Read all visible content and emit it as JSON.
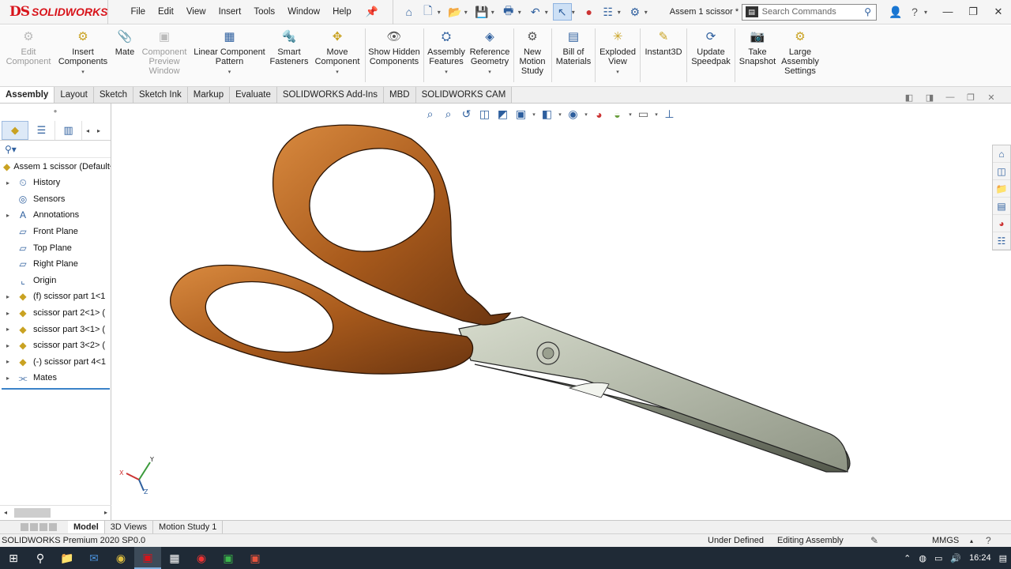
{
  "app": {
    "logo_ds": "DS",
    "logo_text": "SOLIDWORKS",
    "doc_title": "Assem 1 scissor *"
  },
  "menu": [
    "File",
    "Edit",
    "View",
    "Insert",
    "Tools",
    "Window",
    "Help"
  ],
  "search": {
    "placeholder": "Search Commands"
  },
  "commands": [
    {
      "label": "Edit Component",
      "disabled": true
    },
    {
      "label": "Insert Components",
      "disabled": false
    },
    {
      "label": "Mate",
      "disabled": false
    },
    {
      "label": "Component Preview Window",
      "disabled": true
    },
    {
      "label": "Linear Component Pattern",
      "disabled": false
    },
    {
      "label": "Smart Fasteners",
      "disabled": false
    },
    {
      "label": "Move Component",
      "disabled": false
    },
    {
      "label": "Show Hidden Components",
      "disabled": false
    },
    {
      "label": "Assembly Features",
      "disabled": false
    },
    {
      "label": "Reference Geometry",
      "disabled": false
    },
    {
      "label": "New Motion Study",
      "disabled": false
    },
    {
      "label": "Bill of Materials",
      "disabled": false
    },
    {
      "label": "Exploded View",
      "disabled": false
    },
    {
      "label": "Instant3D",
      "disabled": false
    },
    {
      "label": "Update Speedpak",
      "disabled": false
    },
    {
      "label": "Take Snapshot",
      "disabled": false
    },
    {
      "label": "Large Assembly Settings",
      "disabled": false
    }
  ],
  "tabs": [
    "Assembly",
    "Layout",
    "Sketch",
    "Sketch Ink",
    "Markup",
    "Evaluate",
    "SOLIDWORKS Add-Ins",
    "MBD",
    "SOLIDWORKS CAM"
  ],
  "active_tab": "Assembly",
  "tree": {
    "root": "Assem 1 scissor  (Default<",
    "items": [
      {
        "label": "History",
        "expandable": true,
        "icon": "history-icon"
      },
      {
        "label": "Sensors",
        "expandable": false,
        "icon": "sensor-icon"
      },
      {
        "label": "Annotations",
        "expandable": true,
        "icon": "annotation-icon"
      },
      {
        "label": "Front Plane",
        "expandable": false,
        "icon": "plane-icon"
      },
      {
        "label": "Top Plane",
        "expandable": false,
        "icon": "plane-icon"
      },
      {
        "label": "Right Plane",
        "expandable": false,
        "icon": "plane-icon"
      },
      {
        "label": "Origin",
        "expandable": false,
        "icon": "origin-icon"
      },
      {
        "label": "(f) scissor part 1<1",
        "expandable": true,
        "icon": "part-icon"
      },
      {
        "label": "scissor part 2<1> (",
        "expandable": true,
        "icon": "part-icon"
      },
      {
        "label": "scissor part 3<1> (",
        "expandable": true,
        "icon": "part-icon"
      },
      {
        "label": "scissor part 3<2> (",
        "expandable": true,
        "icon": "part-icon"
      },
      {
        "label": "(-) scissor part 4<1",
        "expandable": true,
        "icon": "part-icon"
      },
      {
        "label": "Mates",
        "expandable": true,
        "icon": "mates-icon"
      }
    ]
  },
  "triad": {
    "x": "X",
    "y": "Y",
    "z": "Z"
  },
  "bottom_tabs": [
    "Model",
    "3D Views",
    "Motion Study 1"
  ],
  "status": {
    "product": "SOLIDWORKS Premium 2020 SP0.0",
    "state": "Under Defined",
    "mode": "Editing Assembly",
    "units": "MMGS"
  },
  "taskbar": {
    "time": "16:24"
  },
  "colors": {
    "handle": "#a85a1c",
    "blade": "#b8bdae",
    "accent": "#d8131a"
  }
}
